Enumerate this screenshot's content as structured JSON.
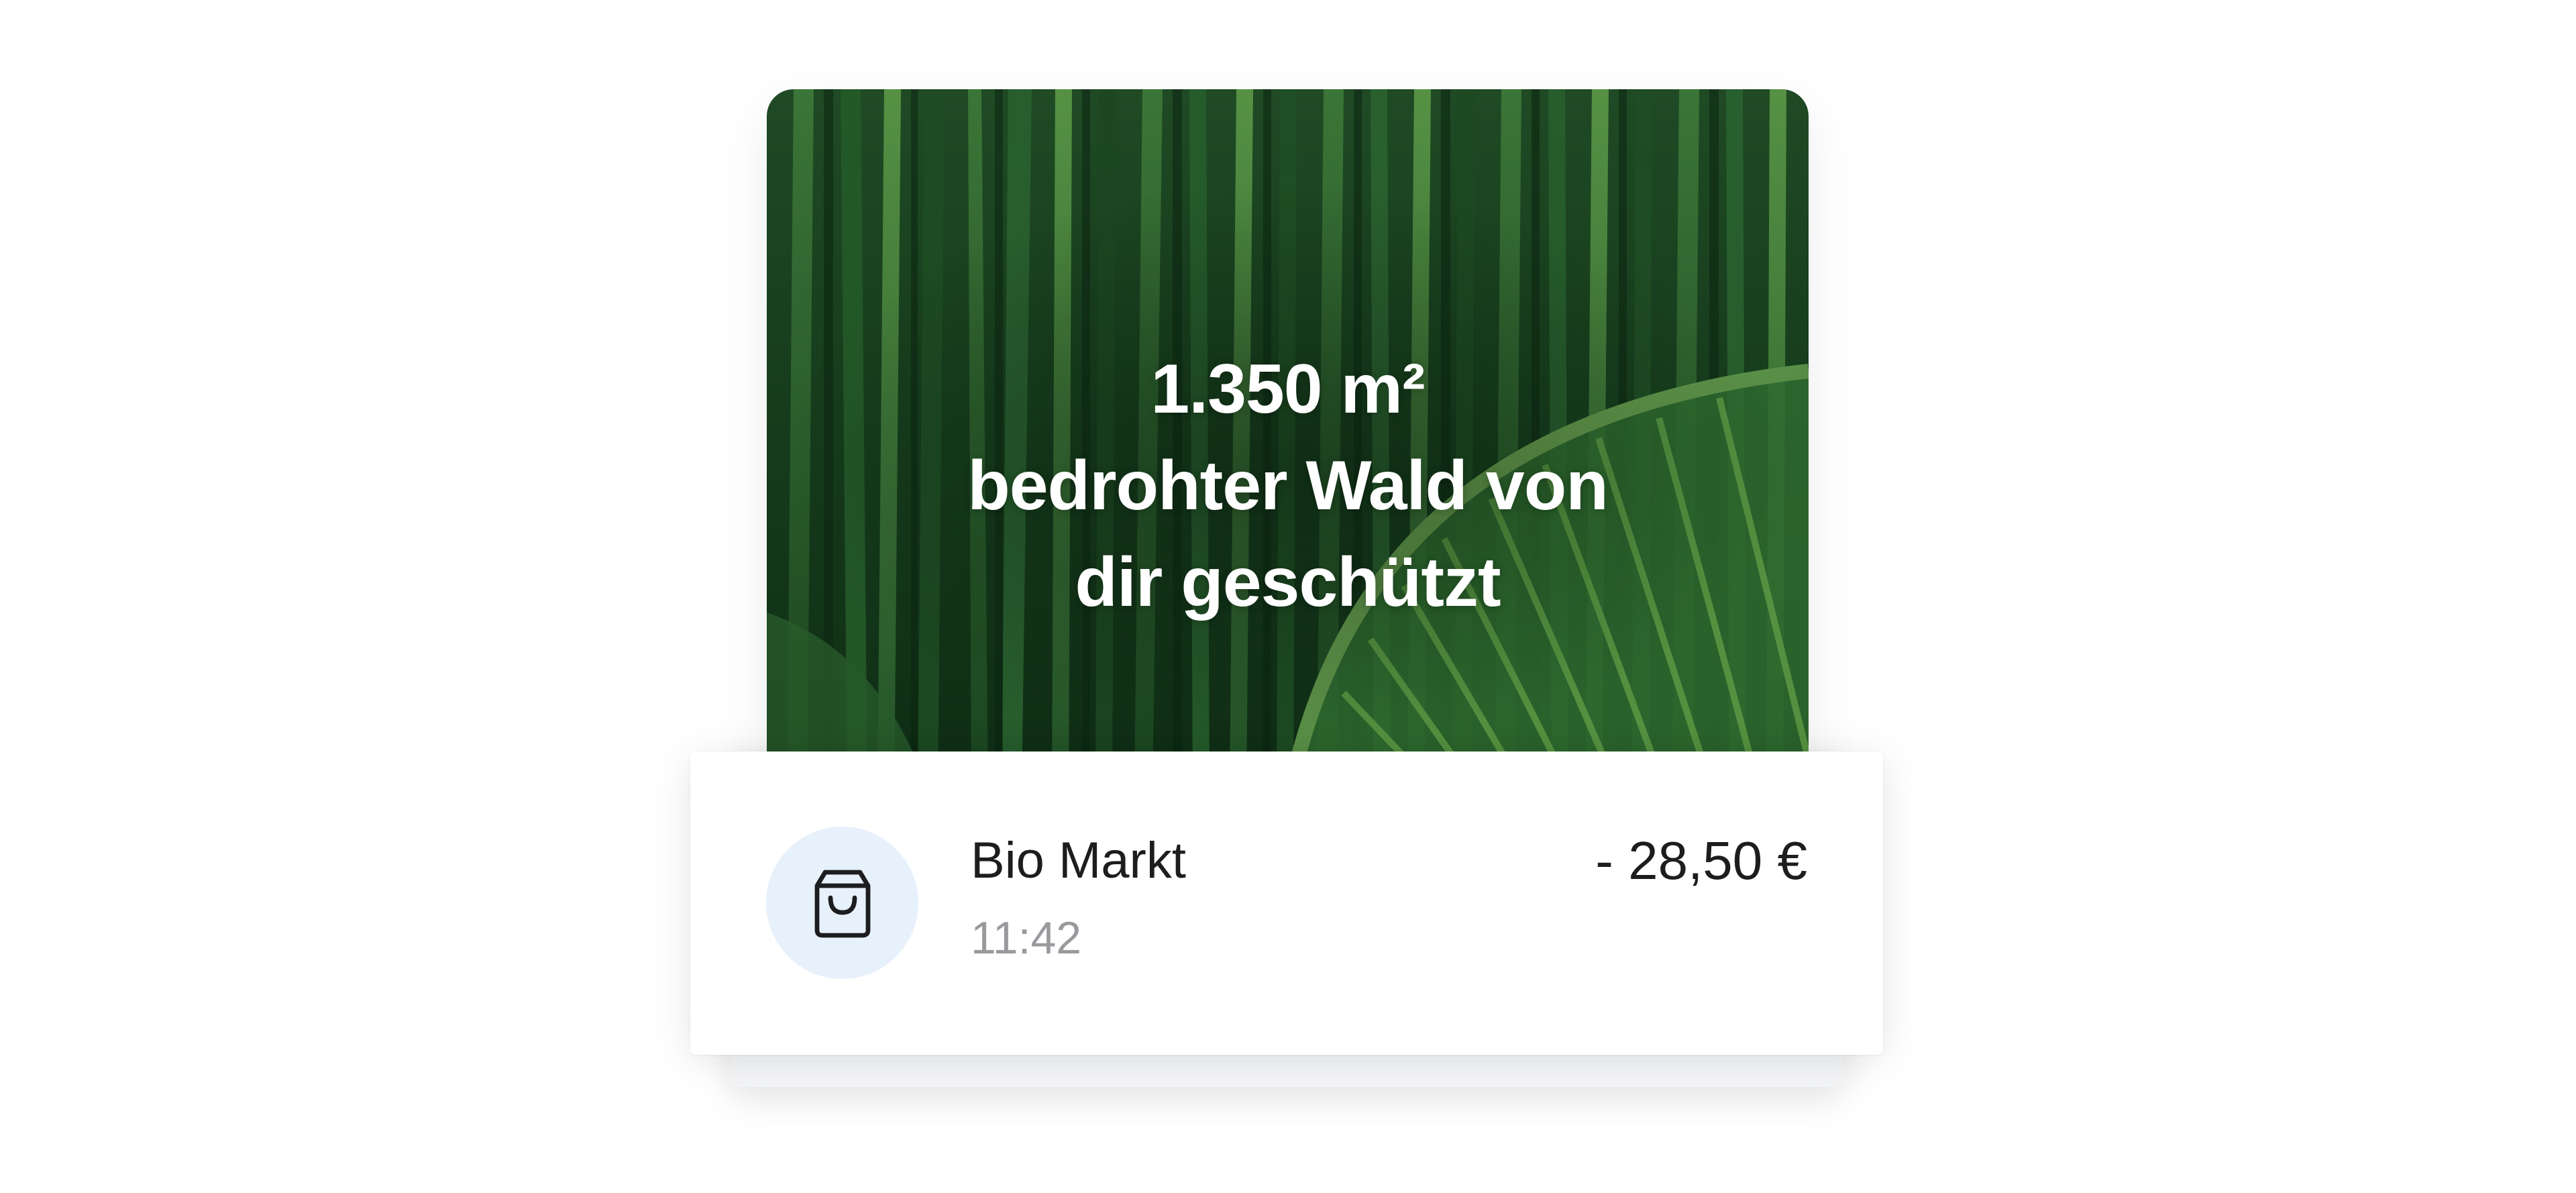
{
  "forest_card": {
    "headline_line1": "1.350 m²",
    "headline_line2": "bedrohter Wald von",
    "headline_line3": "dir geschützt",
    "background_color": "#163c1c"
  },
  "transaction": {
    "merchant": "Bio Markt",
    "time": "11:42",
    "amount": "- 28,50 €",
    "icon": "shopping-bag-icon",
    "icon_background": "#e7f1fb"
  }
}
